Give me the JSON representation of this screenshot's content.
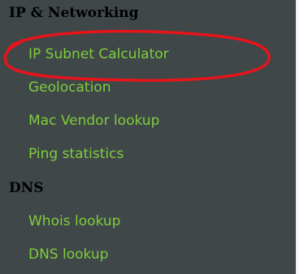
{
  "sections": [
    {
      "heading": "IP & Networking",
      "items": [
        "IP Subnet Calculator",
        "Geolocation",
        "Mac Vendor lookup",
        "Ping statistics"
      ]
    },
    {
      "heading": "DNS",
      "items": [
        "Whois lookup",
        "DNS lookup"
      ]
    }
  ],
  "annotation": {
    "color": "#e8141a",
    "target": "IP Subnet Calculator"
  }
}
